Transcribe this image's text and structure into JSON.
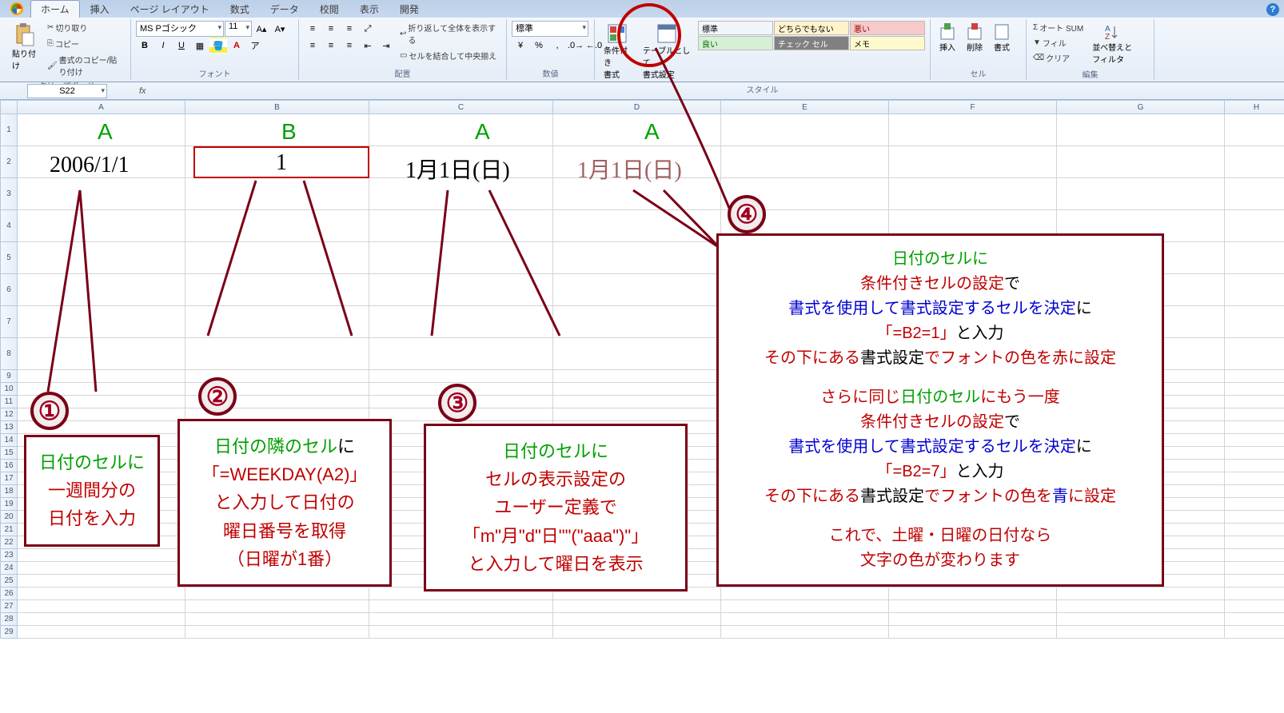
{
  "tabs": [
    "ホーム",
    "挿入",
    "ページ レイアウト",
    "数式",
    "データ",
    "校閲",
    "表示",
    "開発"
  ],
  "clipboard": {
    "paste": "貼り付け",
    "cut": "切り取り",
    "copy": "コピー",
    "fmt": "書式のコピー/貼り付け",
    "label": "クリップボード"
  },
  "font": {
    "name": "MS Pゴシック",
    "size": "11",
    "label": "フォント"
  },
  "align": {
    "wrap": "折り返して全体を表示する",
    "merge": "セルを結合して中央揃え",
    "label": "配置"
  },
  "number": {
    "style": "標準",
    "label": "数値"
  },
  "styles": {
    "cond": "条件付き\n書式",
    "table": "テーブルとして\n書式設定",
    "label": "スタイル",
    "s1": "標準",
    "s2": "どちらでもない",
    "s3": "悪い",
    "s4": "良い",
    "s5": "チェック セル",
    "s6": "メモ"
  },
  "cells": {
    "ins": "挿入",
    "del": "削除",
    "fmt": "書式",
    "label": "セル"
  },
  "edit": {
    "sum": "オート SUM",
    "fill": "フィル",
    "clear": "クリア",
    "sort": "並べ替えと\nフィルタ",
    "label": "編集"
  },
  "namebox": "S22",
  "colLetters": {
    "A": "A",
    "B": "B",
    "A2": "A",
    "A3": "A"
  },
  "cellvals": {
    "a": "2006/1/1",
    "b": "1",
    "c": "1月1日(日)",
    "d": "1月1日(日)"
  },
  "c1": {
    "l1": "日付のセルに",
    "l2": "一週間分の",
    "l3": "日付を入力"
  },
  "c2": {
    "l1a": "日付の隣のセル",
    "l1b": "に",
    "l2": "「=WEEKDAY(A2)」",
    "l3": "と入力して日付の",
    "l4": "曜日番号を取得",
    "l5": "（日曜が1番）"
  },
  "c3": {
    "l1": "日付のセルに",
    "l2": "セルの表示設定の",
    "l3": "ユーザー定義で",
    "l4": "「m\"月\"d\"日\"\"(\"aaa\")\"」",
    "l5": "と入力して曜日を表示"
  },
  "c4": {
    "l1": "日付のセルに",
    "l2a": "条件付きセルの設定",
    "l2b": "で",
    "l3a": "書式を使用して書式設定するセルを決定",
    "l3b": "に",
    "l4a": "「=B2=1」",
    "l4b": "と入力",
    "l5a": "その下にある",
    "l5b": "書式設定",
    "l5c": "でフォントの色を",
    "l5d": "赤",
    "l5e": "に設定",
    "l6a": "さらに同じ",
    "l6b": "日付のセル",
    "l6c": "にもう一度",
    "l7a": "条件付きセルの設定",
    "l7b": "で",
    "l8a": "書式を使用して書式設定するセルを決定",
    "l8b": "に",
    "l9a": "「=B2=7」",
    "l9b": "と入力",
    "l10a": "その下にある",
    "l10b": "書式設定",
    "l10c": "でフォントの色を",
    "l10d": "青",
    "l10e": "に設定",
    "l11": "これで、土曜・日曜の日付なら",
    "l12": "文字の色が変わります"
  }
}
